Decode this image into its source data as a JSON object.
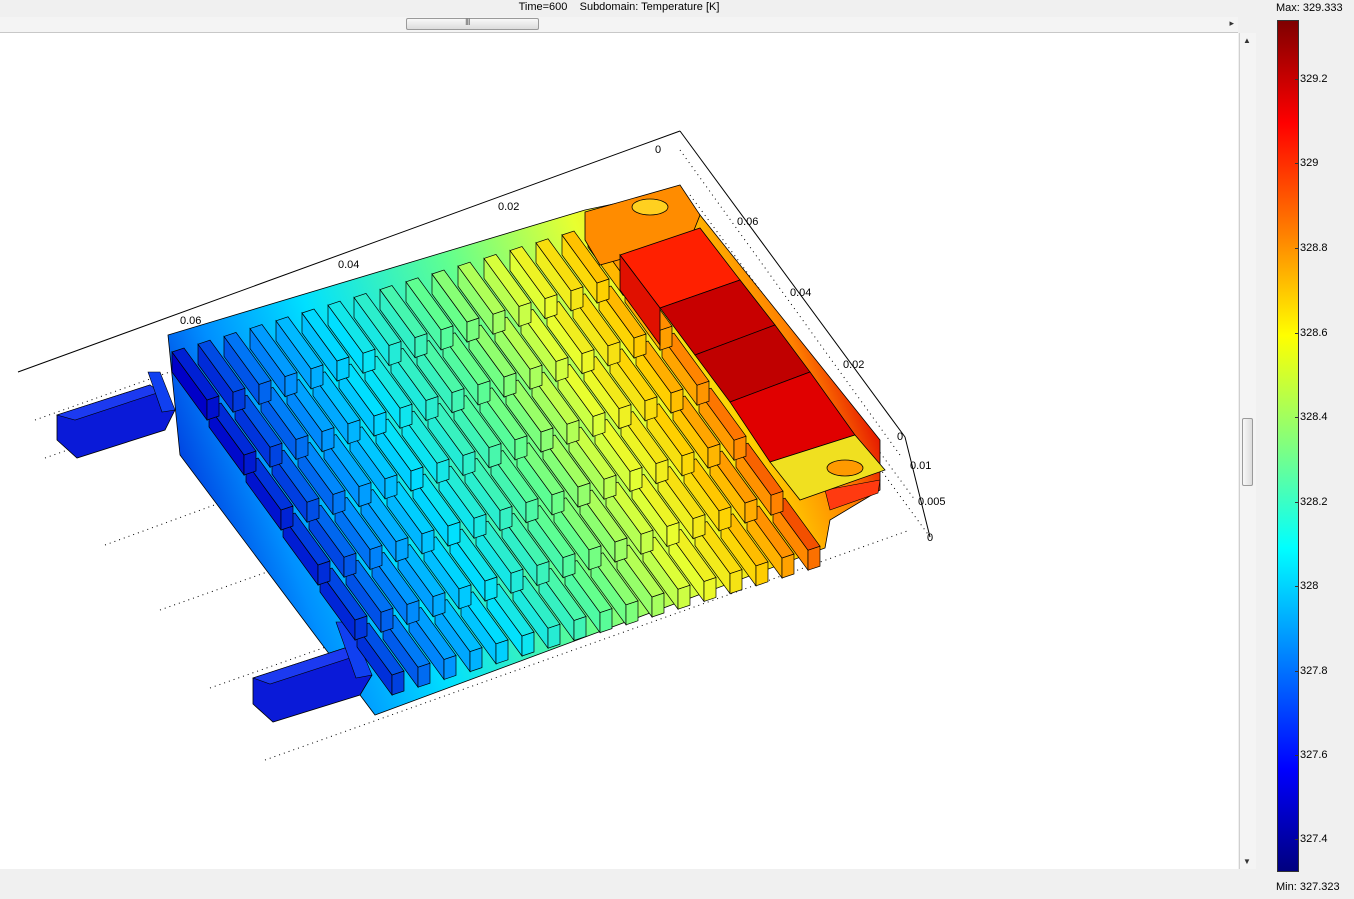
{
  "plot": {
    "time_label": "Time=600",
    "subdomain_label": "Subdomain: Temperature [K]"
  },
  "axes": {
    "x_ticks": [
      "0",
      "0.02",
      "0.04",
      "0.06"
    ],
    "y_ticks": [
      "0.06",
      "0.04",
      "0.02",
      "0"
    ],
    "z_ticks": [
      "0.01",
      "0.005",
      "0"
    ]
  },
  "colorbar": {
    "max_label": "Max: 329.333",
    "min_label": "Min: 327.323",
    "ticks": [
      "329.2",
      "329",
      "328.8",
      "328.6",
      "328.4",
      "328.2",
      "328",
      "327.8",
      "327.6",
      "327.4"
    ],
    "colors": [
      "#7f0000",
      "#ff0000",
      "#ff8000",
      "#ffff00",
      "#80ff80",
      "#00ffff",
      "#0080ff",
      "#0000ff",
      "#00007f"
    ]
  },
  "scrollbars": {
    "thumb_grip": "III"
  }
}
